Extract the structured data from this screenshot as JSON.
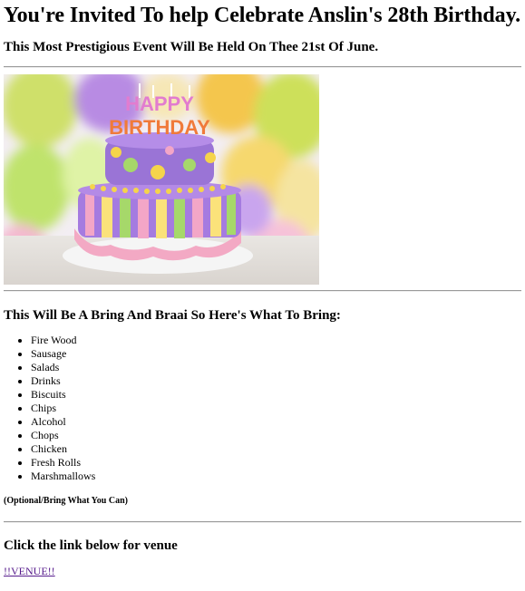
{
  "page": {
    "title": "You're Invited To help Celebrate Anslin's 28th Birthday.",
    "subtitle": "This Most Prestigious Event Will Be Held On Thee 21st Of June.",
    "image": {
      "alt": "Birthday cake",
      "candle_text_line1": "HAPPY",
      "candle_text_line2": "BIRTHDAY"
    },
    "bring_heading": "This Will Be A Bring And Braai So Here's What To Bring:",
    "bring_items": [
      "Fire Wood",
      "Sausage",
      "Salads",
      "Drinks",
      "Biscuits",
      "Chips",
      "Alcohol",
      "Chops",
      "Chicken",
      "Fresh Rolls",
      "Marshmallows"
    ],
    "optional_note": "(Optional/Bring What You Can)",
    "venue_heading": "Click the link below for venue",
    "venue_link": "!!VENUE!!",
    "colors": {
      "link_visited": "#551a8b",
      "rule": "#9a9a9a"
    }
  }
}
